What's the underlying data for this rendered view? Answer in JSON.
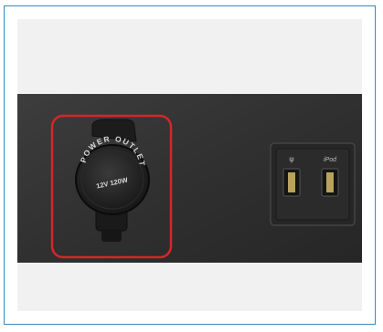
{
  "figure": {
    "outlet_label_line1": "POWER OUTLET",
    "outlet_label_line2": "12V 120W",
    "usb_port_1_label": "ψ",
    "usb_port_2_label": "iPod",
    "highlight_color": "#d6252b"
  }
}
